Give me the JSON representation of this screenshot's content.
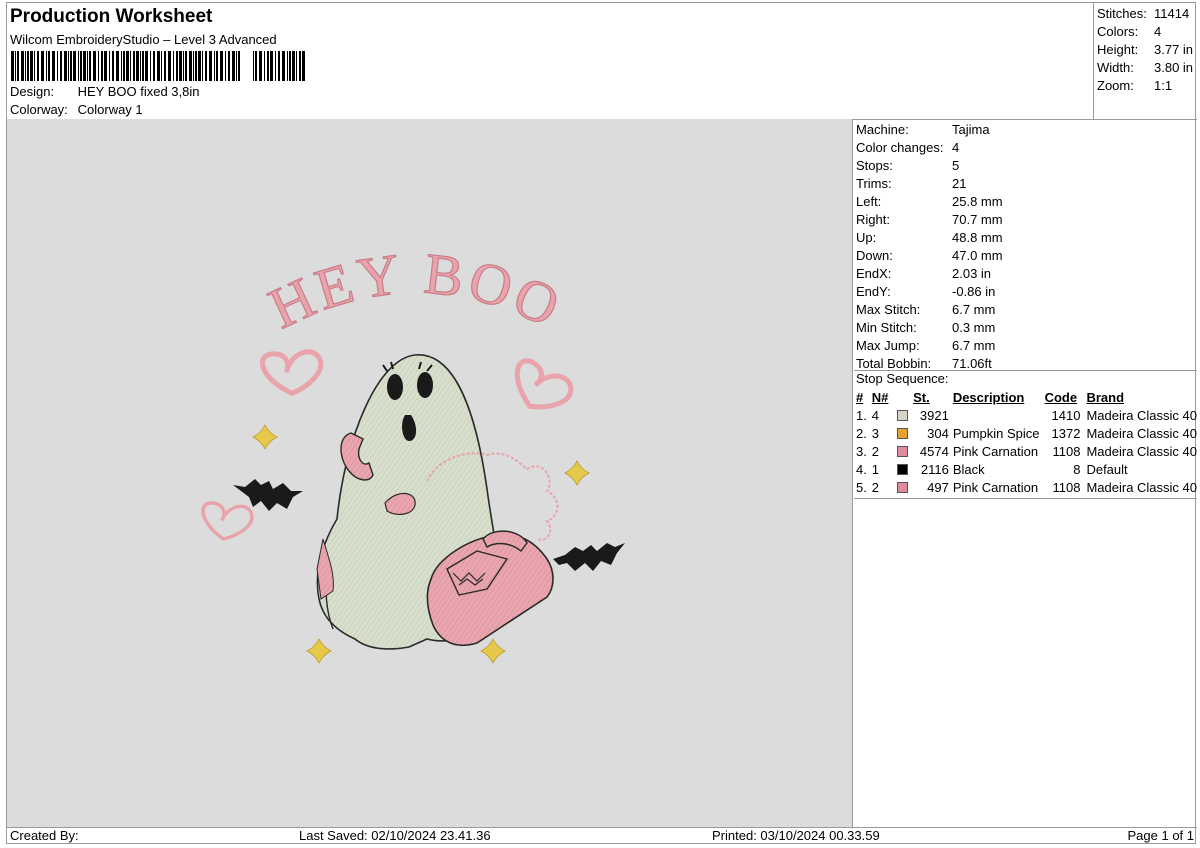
{
  "header": {
    "title": "Production Worksheet",
    "subtitle": "Wilcom EmbroideryStudio – Level 3 Advanced",
    "design_label": "Design:",
    "design_value": "HEY BOO fixed 3,8in",
    "colorway_label": "Colorway:",
    "colorway_value": "Colorway 1"
  },
  "stats": [
    {
      "k": "Stitches:",
      "v": "11414"
    },
    {
      "k": "Colors:",
      "v": "4"
    },
    {
      "k": "Height:",
      "v": "3.77 in"
    },
    {
      "k": "Width:",
      "v": "3.80 in"
    },
    {
      "k": "Zoom:",
      "v": "1:1"
    }
  ],
  "machine_info": [
    {
      "k": "Machine:",
      "v": "Tajima"
    },
    {
      "k": "Color changes:",
      "v": "4"
    },
    {
      "k": "Stops:",
      "v": "5"
    },
    {
      "k": "Trims:",
      "v": "21"
    },
    {
      "k": "Left:",
      "v": "25.8 mm"
    },
    {
      "k": "Right:",
      "v": "70.7 mm"
    },
    {
      "k": "Up:",
      "v": "48.8 mm"
    },
    {
      "k": "Down:",
      "v": "47.0 mm"
    },
    {
      "k": "EndX:",
      "v": "2.03 in"
    },
    {
      "k": "EndY:",
      "v": "-0.86 in"
    },
    {
      "k": "Max Stitch:",
      "v": "6.7 mm"
    },
    {
      "k": "Min Stitch:",
      "v": "0.3 mm"
    },
    {
      "k": "Max Jump:",
      "v": "6.7 mm"
    },
    {
      "k": "Total Bobbin:",
      "v": "71.06ft"
    }
  ],
  "stop_sequence": {
    "title": "Stop Sequence:",
    "columns": [
      "#",
      "N#",
      "St.",
      "Description",
      "Code",
      "Brand"
    ],
    "rows": [
      {
        "idx": "1.",
        "n": "4",
        "color": "#d9d4c8",
        "st": "3921",
        "desc": "",
        "code": "1410",
        "brand": "Madeira Classic 40"
      },
      {
        "idx": "2.",
        "n": "3",
        "color": "#e8a030",
        "st": "304",
        "desc": "Pumpkin Spice",
        "code": "1372",
        "brand": "Madeira Classic 40"
      },
      {
        "idx": "3.",
        "n": "2",
        "color": "#e08a9e",
        "st": "4574",
        "desc": "Pink Carnation",
        "code": "1108",
        "brand": "Madeira Classic 40"
      },
      {
        "idx": "4.",
        "n": "1",
        "color": "#000000",
        "st": "2116",
        "desc": "Black",
        "code": "8",
        "brand": "Default"
      },
      {
        "idx": "5.",
        "n": "2",
        "color": "#e08a9e",
        "st": "497",
        "desc": "Pink Carnation",
        "code": "1108",
        "brand": "Madeira Classic 40"
      }
    ]
  },
  "design_preview": {
    "text": "HEY BOO",
    "colors": {
      "pink": "#e8a3ab",
      "ghost": "#d5dcc8",
      "gold": "#e6c84a",
      "black": "#1a1a1a",
      "background": "#dcdcdc"
    }
  },
  "footer": {
    "created_by": "Created By:",
    "last_saved": "Last Saved: 02/10/2024 23.41.36",
    "printed": "Printed: 03/10/2024 00.33.59",
    "page": "Page 1 of 1"
  }
}
